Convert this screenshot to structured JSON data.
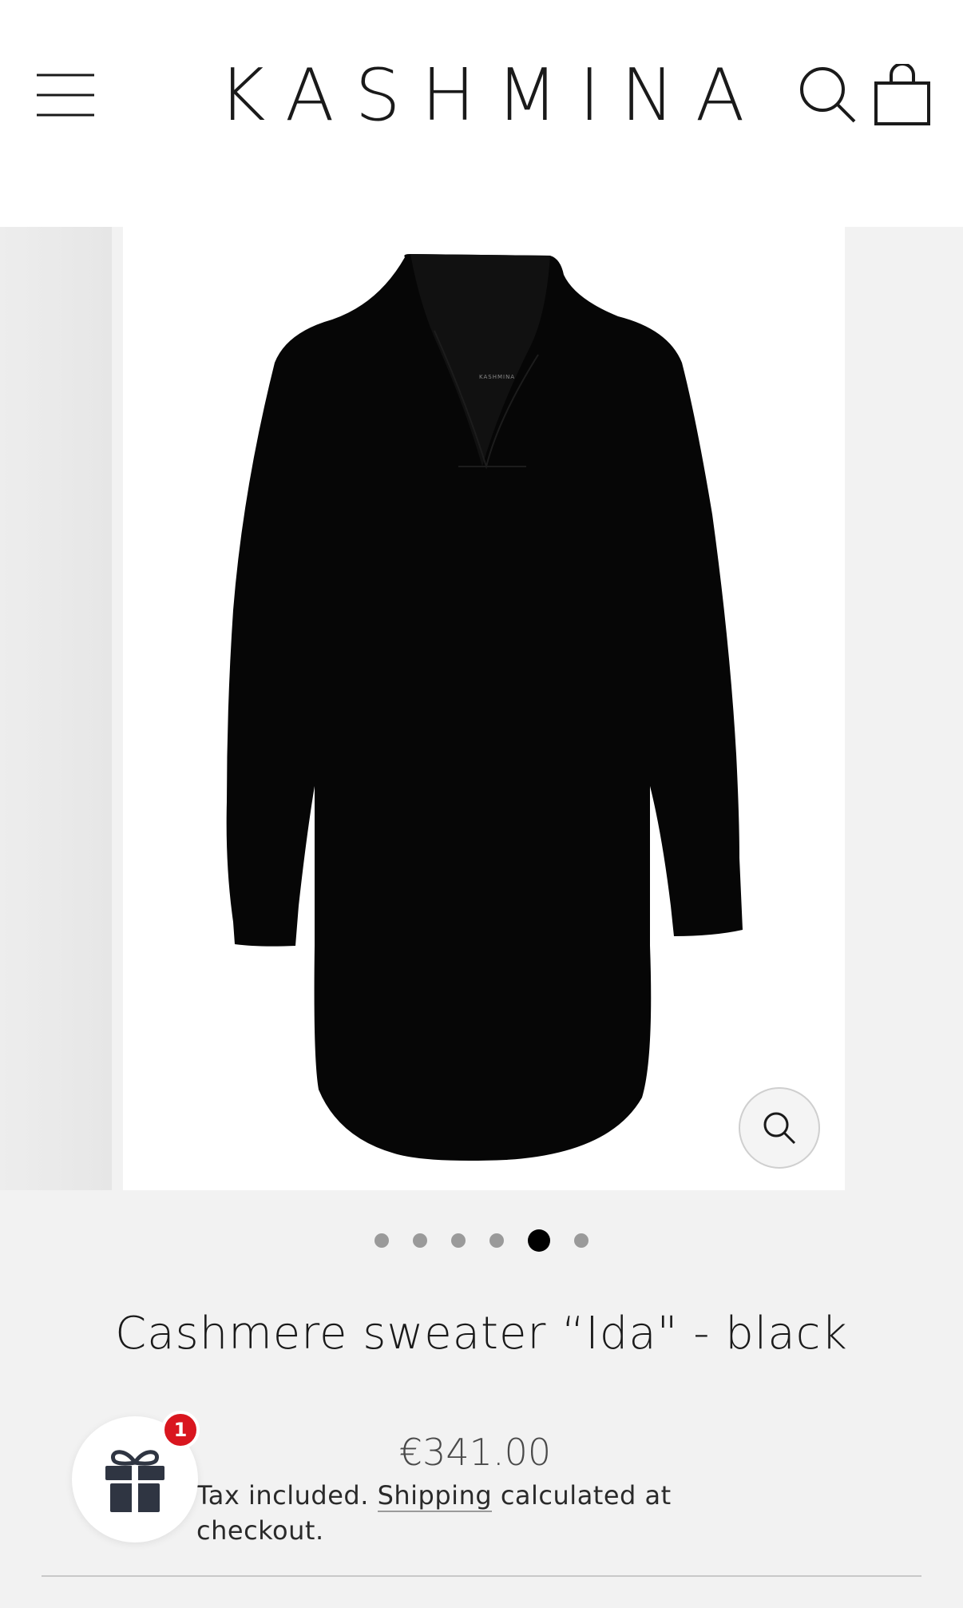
{
  "header": {
    "brand": "KASHMINA",
    "menu_icon": "hamburger-menu-icon",
    "search_icon": "search-icon",
    "cart_icon": "shopping-bag-icon"
  },
  "gallery": {
    "slide_count": 6,
    "active_slide": 5,
    "zoom_icon": "zoom-search-icon"
  },
  "product": {
    "title": "Cashmere sweater “Ida\" - black",
    "price": "€341.00",
    "tax_text_before": "Tax included. ",
    "shipping_link": "Shipping",
    "tax_text_after": " calculated at checkout."
  },
  "gift_widget": {
    "icon": "gift-icon",
    "badge_count": "1",
    "badge_color": "#d9161f"
  }
}
